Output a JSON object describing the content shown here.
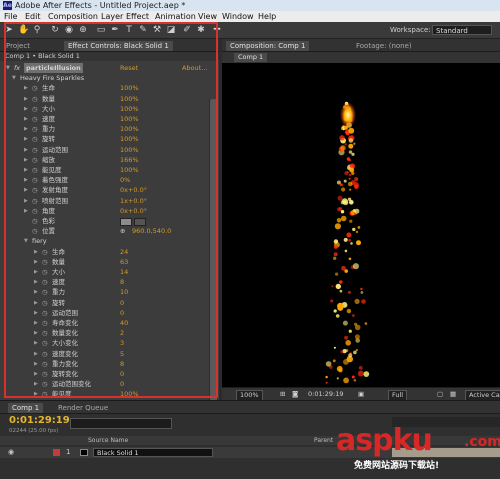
{
  "window": {
    "title": "Adobe After Effects - Untitled Project.aep *",
    "app_badge": "Ae"
  },
  "menu": [
    "File",
    "Edit",
    "Composition",
    "Layer",
    "Effect",
    "Animation",
    "View",
    "Window",
    "Help"
  ],
  "toolbar": {
    "workspace_label": "Workspace:",
    "workspace_value": "Standard"
  },
  "left_panel": {
    "tabs": [
      "Project",
      "Effect Controls: Black Solid 1"
    ],
    "breadcrumb": "Comp 1 • Black Solid 1",
    "effect": {
      "fx": "fx",
      "name": "particleIllusion",
      "reset": "Reset",
      "about": "About..."
    },
    "emitter": "Heavy Fire Sparkles",
    "emitter_props": [
      {
        "label": "生命",
        "value": "100%"
      },
      {
        "label": "数量",
        "value": "100%"
      },
      {
        "label": "大小",
        "value": "100%"
      },
      {
        "label": "速度",
        "value": "100%"
      },
      {
        "label": "重力",
        "value": "100%"
      },
      {
        "label": "旋转",
        "value": "100%"
      },
      {
        "label": "运动范围",
        "value": "100%"
      },
      {
        "label": "缩放",
        "value": "166%"
      },
      {
        "label": "能见度",
        "value": "100%"
      },
      {
        "label": "着色强度",
        "value": "0%"
      },
      {
        "label": "发射角度",
        "value": "0x+0.0°"
      },
      {
        "label": "喷射范围",
        "value": "1x+0.0°"
      },
      {
        "label": "角度",
        "value": "0x+0.0°"
      }
    ],
    "color_label": "色彩",
    "position_label": "位置",
    "position_value": "960.0,540.0",
    "group": "fiery",
    "fiery_props": [
      {
        "label": "生命",
        "value": "24"
      },
      {
        "label": "数量",
        "value": "63"
      },
      {
        "label": "大小",
        "value": "14"
      },
      {
        "label": "速度",
        "value": "8"
      },
      {
        "label": "重力",
        "value": "10"
      },
      {
        "label": "旋转",
        "value": "0"
      },
      {
        "label": "运动范围",
        "value": "0"
      },
      {
        "label": "寿命变化",
        "value": "40"
      },
      {
        "label": "数量变化",
        "value": "2"
      },
      {
        "label": "大小变化",
        "value": "3"
      },
      {
        "label": "速度变化",
        "value": "5"
      },
      {
        "label": "重力变化",
        "value": "8"
      },
      {
        "label": "旋转变化",
        "value": "0"
      },
      {
        "label": "运动范围变化",
        "value": "0"
      },
      {
        "label": "能见度",
        "value": "100%"
      }
    ]
  },
  "comp_panel": {
    "tabs": [
      "Composition: Comp 1",
      "Footage: (none)"
    ],
    "comp_chip": "Comp 1",
    "zoom": "100%",
    "timecode": "0:01:29:19",
    "resolution": "Full",
    "active_camera": "Active Cam"
  },
  "timeline": {
    "tabs": [
      "Comp 1",
      "Render Queue"
    ],
    "timecode": "0:01:29:19",
    "fps": "02244 (25.00 fps)",
    "col_source": "Source Name",
    "col_parent": "Parent",
    "layer_index": "1",
    "layer_name": "Black Solid 1"
  },
  "watermark": {
    "logo": "aspku",
    "suffix": ".com",
    "subtitle": "免费网站源码下载站!"
  }
}
